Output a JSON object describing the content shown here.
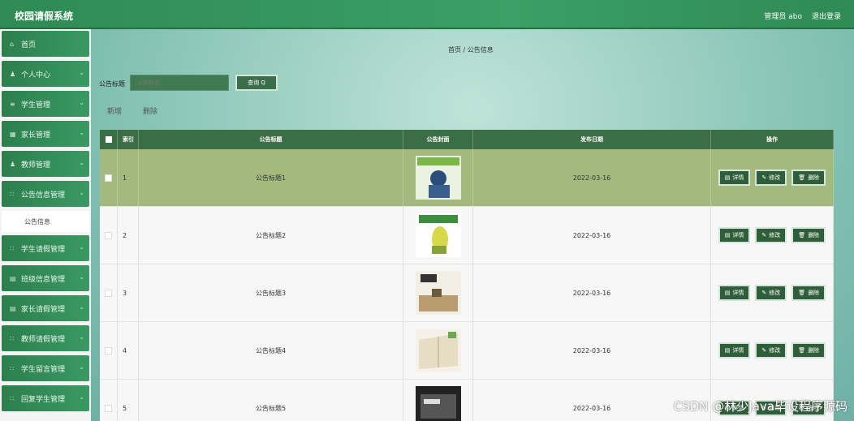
{
  "header": {
    "title": "校园请假系统",
    "admin": "管理员 abo",
    "logout": "退出登录"
  },
  "sidebar": {
    "items": [
      {
        "icon": "⌂",
        "label": "首页"
      },
      {
        "icon": "♟",
        "label": "个人中心"
      },
      {
        "icon": "≡",
        "label": "学生管理"
      },
      {
        "icon": "▦",
        "label": "家长管理"
      },
      {
        "icon": "♟",
        "label": "教师管理"
      },
      {
        "icon": "∷",
        "label": "公告信息管理"
      },
      {
        "icon": "∷",
        "label": "学生请假管理"
      },
      {
        "icon": "▤",
        "label": "班级信息管理"
      },
      {
        "icon": "▤",
        "label": "家长请假管理"
      },
      {
        "icon": "∷",
        "label": "教师请假管理"
      },
      {
        "icon": "∷",
        "label": "学生留言管理"
      },
      {
        "icon": "∷",
        "label": "回复学生管理"
      }
    ],
    "subitem": "公告信息"
  },
  "breadcrumb": "首页 / 公告信息",
  "search": {
    "label": "公告标题",
    "placeholder": "公告标题",
    "button": "查询 Q"
  },
  "actions": {
    "add": "新增",
    "delete": "删除"
  },
  "table": {
    "headers": [
      "索引",
      "公告标题",
      "公告封面",
      "发布日期",
      "操作"
    ],
    "rows": [
      {
        "index": "1",
        "title": "公告标题1",
        "date": "2022-03-16"
      },
      {
        "index": "2",
        "title": "公告标题2",
        "date": "2022-03-16"
      },
      {
        "index": "3",
        "title": "公告标题3",
        "date": "2022-03-16"
      },
      {
        "index": "4",
        "title": "公告标题4",
        "date": "2022-03-16"
      },
      {
        "index": "5",
        "title": "公告标题5",
        "date": "2022-03-16"
      }
    ],
    "ops": {
      "detail": "详情",
      "edit": "修改",
      "delete": "删除"
    }
  },
  "watermark": "CSDN @林少Java毕设程序源码",
  "colors": {
    "brand": "#3aa065",
    "table_header": "#3c6e45",
    "selected_row": "#a2ba7d"
  }
}
